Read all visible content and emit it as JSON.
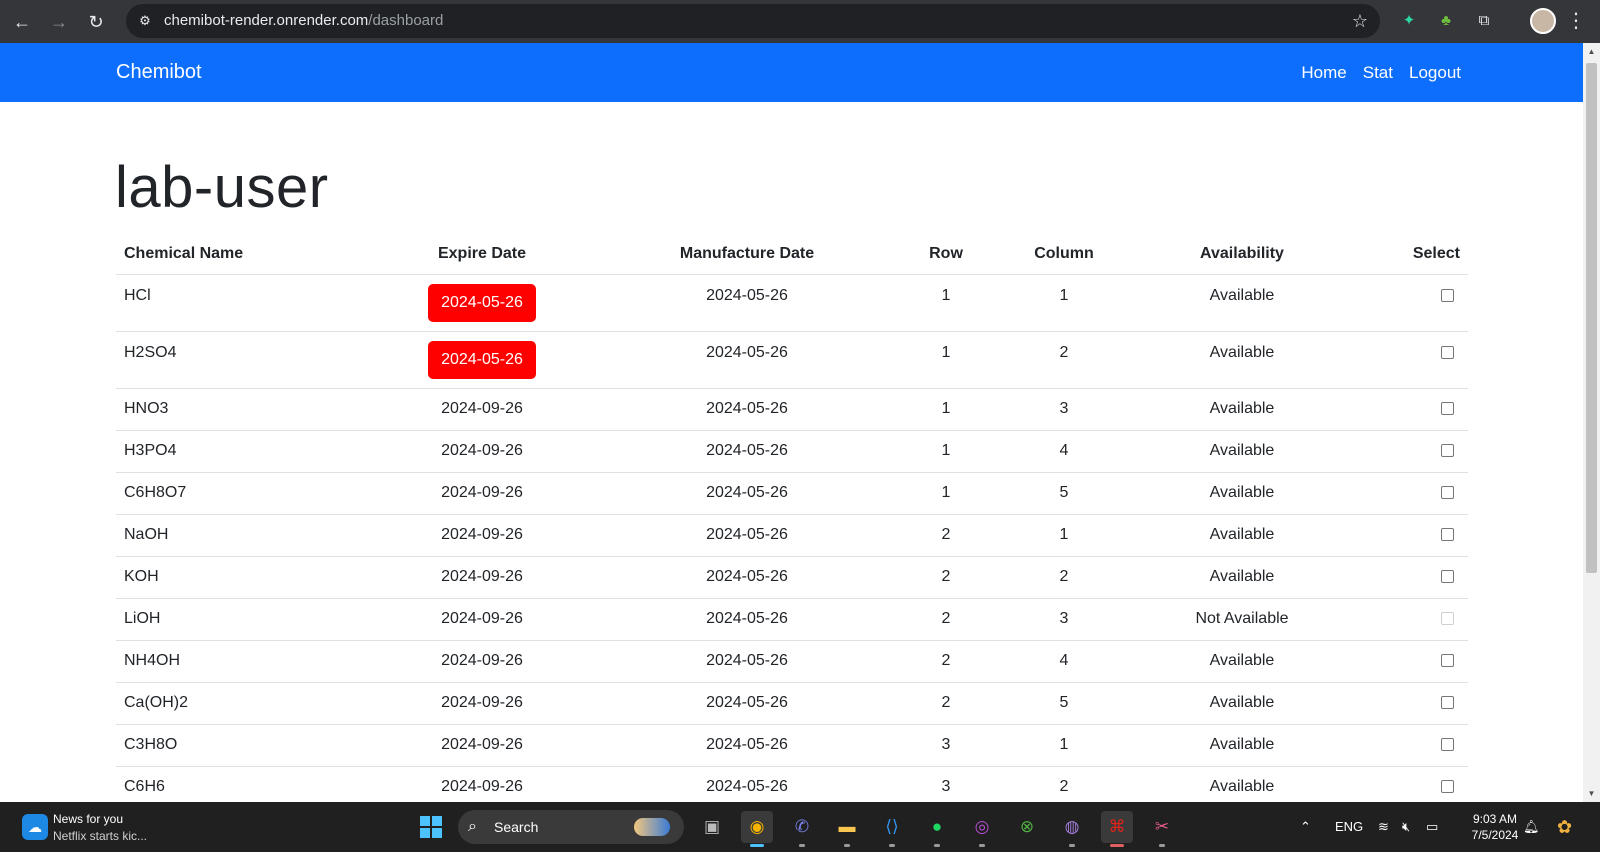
{
  "browser": {
    "url_host": "chemibot-render.onrender.com",
    "url_path": "/dashboard"
  },
  "navbar": {
    "brand": "Chemibot",
    "links": [
      "Home",
      "Stat",
      "Logout"
    ]
  },
  "page": {
    "title": "lab-user"
  },
  "table": {
    "headers": [
      "Chemical Name",
      "Expire Date",
      "Manufacture Date",
      "Row",
      "Column",
      "Availability",
      "Select"
    ],
    "rows": [
      {
        "name": "HCl",
        "expire": "2024-05-26",
        "expired": true,
        "manufacture": "2024-05-26",
        "row": "1",
        "column": "1",
        "availability": "Available",
        "selectable": true
      },
      {
        "name": "H2SO4",
        "expire": "2024-05-26",
        "expired": true,
        "manufacture": "2024-05-26",
        "row": "1",
        "column": "2",
        "availability": "Available",
        "selectable": true
      },
      {
        "name": "HNO3",
        "expire": "2024-09-26",
        "expired": false,
        "manufacture": "2024-05-26",
        "row": "1",
        "column": "3",
        "availability": "Available",
        "selectable": true
      },
      {
        "name": "H3PO4",
        "expire": "2024-09-26",
        "expired": false,
        "manufacture": "2024-05-26",
        "row": "1",
        "column": "4",
        "availability": "Available",
        "selectable": true
      },
      {
        "name": "C6H8O7",
        "expire": "2024-09-26",
        "expired": false,
        "manufacture": "2024-05-26",
        "row": "1",
        "column": "5",
        "availability": "Available",
        "selectable": true
      },
      {
        "name": "NaOH",
        "expire": "2024-09-26",
        "expired": false,
        "manufacture": "2024-05-26",
        "row": "2",
        "column": "1",
        "availability": "Available",
        "selectable": true
      },
      {
        "name": "KOH",
        "expire": "2024-09-26",
        "expired": false,
        "manufacture": "2024-05-26",
        "row": "2",
        "column": "2",
        "availability": "Available",
        "selectable": true
      },
      {
        "name": "LiOH",
        "expire": "2024-09-26",
        "expired": false,
        "manufacture": "2024-05-26",
        "row": "2",
        "column": "3",
        "availability": "Not Available",
        "selectable": false
      },
      {
        "name": "NH4OH",
        "expire": "2024-09-26",
        "expired": false,
        "manufacture": "2024-05-26",
        "row": "2",
        "column": "4",
        "availability": "Available",
        "selectable": true
      },
      {
        "name": "Ca(OH)2",
        "expire": "2024-09-26",
        "expired": false,
        "manufacture": "2024-05-26",
        "row": "2",
        "column": "5",
        "availability": "Available",
        "selectable": true
      },
      {
        "name": "C3H8O",
        "expire": "2024-09-26",
        "expired": false,
        "manufacture": "2024-05-26",
        "row": "3",
        "column": "1",
        "availability": "Available",
        "selectable": true
      },
      {
        "name": "C6H6",
        "expire": "2024-09-26",
        "expired": false,
        "manufacture": "2024-05-26",
        "row": "3",
        "column": "2",
        "availability": "Available",
        "selectable": true
      }
    ]
  },
  "colors": {
    "navbar": "#0d6efd",
    "expired_badge": "#ff0000"
  },
  "taskbar": {
    "news_title": "News for you",
    "news_sub": "Netflix starts kic...",
    "search_label": "Search",
    "language": "ENG",
    "time": "9:03 AM",
    "date": "7/5/2024",
    "apps": [
      "file-explorer-icon",
      "chrome-icon",
      "teams-icon",
      "folder-icon",
      "vscode-icon",
      "spotify-icon",
      "app-icon",
      "xbox-icon",
      "github-icon",
      "acrobat-icon",
      "snipping-tool-icon"
    ]
  }
}
